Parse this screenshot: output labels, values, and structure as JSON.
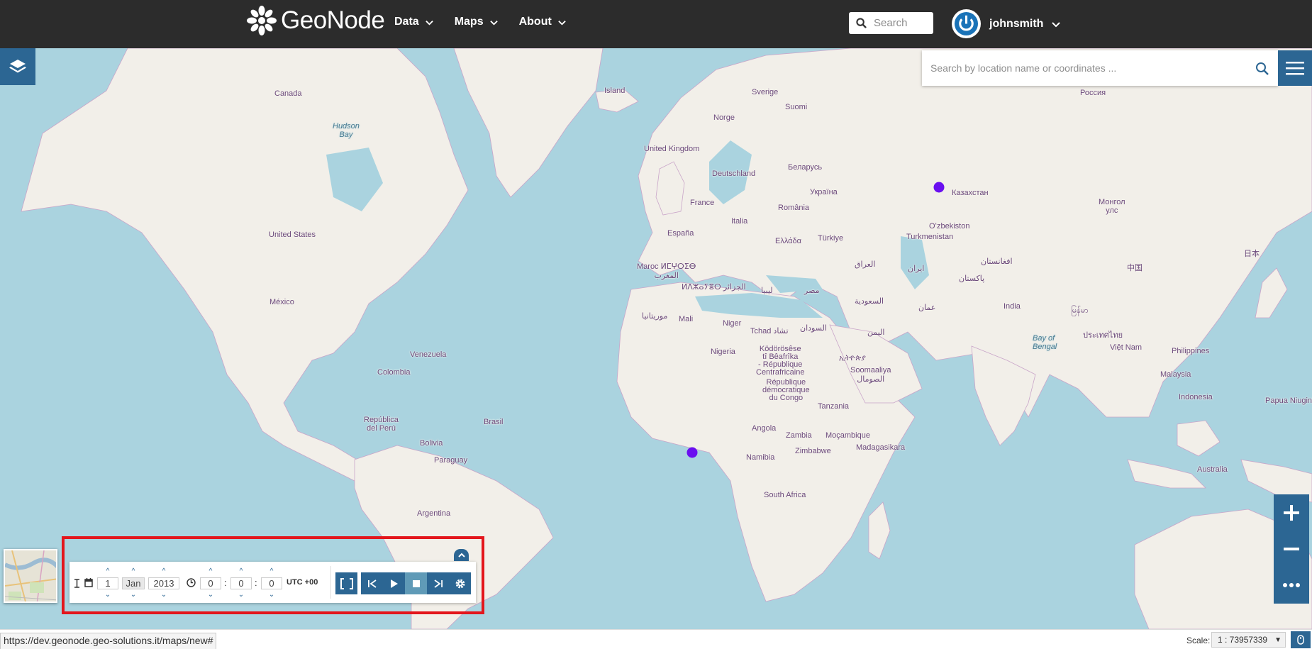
{
  "brand": {
    "name": "GeoNode"
  },
  "nav": {
    "items": [
      {
        "label": "Data"
      },
      {
        "label": "Maps"
      },
      {
        "label": "About"
      }
    ]
  },
  "header_search": {
    "placeholder": "Search"
  },
  "user": {
    "name": "johnsmith"
  },
  "location_search": {
    "placeholder": "Search by location name or coordinates ..."
  },
  "map": {
    "labels": {
      "canada": "Canada",
      "island": "Island",
      "rossiya": "Россия",
      "sverige": "Sverige",
      "suomi": "Suomi",
      "norge": "Norge",
      "hudson": "Hudson\nBay",
      "uk": "United Kingdom",
      "deutschland": "Deutschland",
      "belarus": "Беларусь",
      "ukraina": "Україна",
      "kazakhstan": "Казахстан",
      "mongol": "Монгол\nулс",
      "usa": "United States",
      "france": "France",
      "romania": "România",
      "uzbekistan": "Oʻzbekiston",
      "turkmenistan": "Turkmenistan",
      "italia": "Italia",
      "espana": "España",
      "turkiye": "Türkiye",
      "ellada": "Ελλάδα",
      "nihon": "日本",
      "zhongguo": "中国",
      "iraq": "العراق",
      "iran": "ایران",
      "afghanistan": "افغانستان",
      "pakistan": "پاکستان",
      "maroc": "Maroc ⵍⵎⵖⵔⵉⴱ\nالمغرب",
      "algeria": "ⵍⴷⵣⴰⵢⴻⵔ الجزائر",
      "libya": "ليبيا",
      "misr": "مصر",
      "saudi": "السعودية",
      "oman": "عمان",
      "india": "India",
      "mexico": "México",
      "mauritania": "موريتانيا",
      "mali": "Mali",
      "niger": "Niger",
      "tchad": "Tchad تشاد",
      "sudan": "السودان",
      "yemen": "اليمن",
      "myanmar": "မြန်မာ",
      "bay_bengal": "Bay of\nBengal",
      "thailand": "ประเทศไทย",
      "vietnam": "Việt Nam",
      "philippines": "Philippines",
      "venezuela": "Venezuela",
      "nigeria": "Nigeria",
      "car": "Ködörösêse\ntî Bêafrîka\n- République\nCentrafricaine",
      "ethiopia": "ኢትዮጵያ",
      "somalia": "Soomaaliya\nالصومال",
      "colombia": "Colombia",
      "rdc": "République\ndémocratique\ndu Congo",
      "malaysia": "Malaysia",
      "tanzania": "Tanzania",
      "indonesia": "Indonesia",
      "papua": "Papua Niugini",
      "brasil": "Brasil",
      "peru": "República\ndel Perú",
      "angola": "Angola",
      "zambia": "Zambia",
      "mocambique": "Moçambique",
      "bolivia": "Bolivia",
      "zimbabwe": "Zimbabwe",
      "madagasikara": "Madagasikara",
      "namibia": "Namibia",
      "paraguay": "Paraguay",
      "australia": "Australia",
      "south_africa": "South Africa",
      "argentina": "Argentina"
    },
    "point_color": "#6a0ff0"
  },
  "timeline": {
    "day": "1",
    "month": "Jan",
    "year": "2013",
    "hour": "0",
    "minute": "0",
    "second": "0",
    "separator": ":",
    "timezone": "UTC +00"
  },
  "status": {
    "url": "https://dev.geonode.geo-solutions.it/maps/new#",
    "scale_label": "Scale:",
    "scale_value": "1 : 73957339"
  },
  "colors": {
    "brand": "#2c6693",
    "navbar": "#2c2c2c",
    "water": "#aad3df",
    "land": "#f2efe9",
    "highlight": "#e3161c"
  }
}
